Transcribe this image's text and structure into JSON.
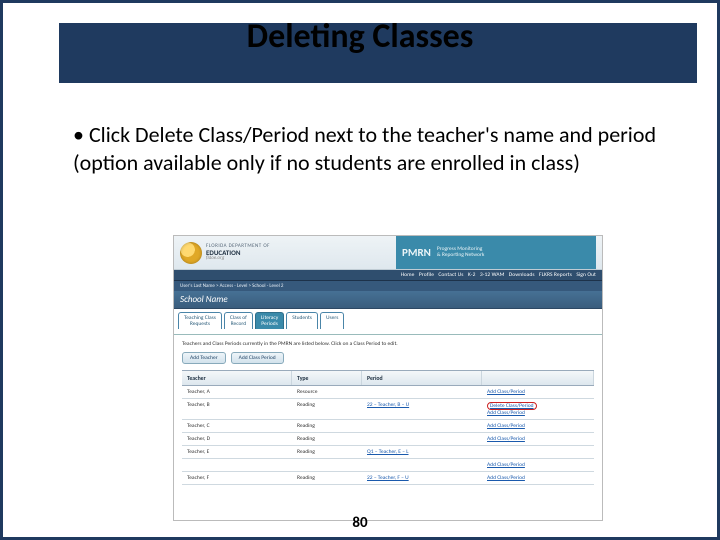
{
  "slide": {
    "title": "Deleting Classes",
    "bullet": "Click Delete Class/Period next to the teacher's name and period (option available only if no students are enrolled in class)",
    "page": "80"
  },
  "ss": {
    "dept_line1": "FLORIDA DEPARTMENT OF",
    "dept_line2": "EDUCATION",
    "dept_line3": "fldoe.org",
    "pmrn": "PMRN",
    "pmrn_sub1": "Progress Monitoring",
    "pmrn_sub2": "& Reporting Network",
    "nav": [
      "Home",
      "Profile",
      "Contact Us",
      "K-2",
      "3-12 WAM",
      "Downloads",
      "FLKRS Reports",
      "Sign Out"
    ],
    "breadcrumb": "User's Last Name  >  Access - Level  >  School - Level 2",
    "school": "School Name",
    "tabs": {
      "t0a": "Teaching Class",
      "t0b": "Requests",
      "t1a": "Class of",
      "t1b": "Record",
      "t2a": "Literacy",
      "t2b": "Periods",
      "t3": "Students",
      "t4": "Users"
    },
    "instruct": "Teachers and Class Periods currently in the PMRN are listed below. Click on a Class Period to edit.",
    "btn1": "Add Teacher",
    "btn2": "Add Class Period",
    "cols": {
      "c0": "Teacher",
      "c1": "Type",
      "c2": "Period"
    },
    "link_add": "Add Class/Period",
    "link_del": "Delete Class/Period",
    "rows": [
      {
        "t": "Teacher, A",
        "y": "Resource",
        "p": ""
      },
      {
        "t": "Teacher, B",
        "y": "Reading",
        "p": "22 – Teacher, B – U"
      },
      {
        "t": "Teacher, C",
        "y": "Reading",
        "p": ""
      },
      {
        "t": "Teacher, D",
        "y": "Reading",
        "p": ""
      },
      {
        "t": "Teacher, E",
        "y": "Reading",
        "p": "Q1 – Teacher, E – L"
      },
      {
        "t": "Teacher, F",
        "y": "Reading",
        "p": "22 – Teacher, F – U"
      }
    ]
  }
}
